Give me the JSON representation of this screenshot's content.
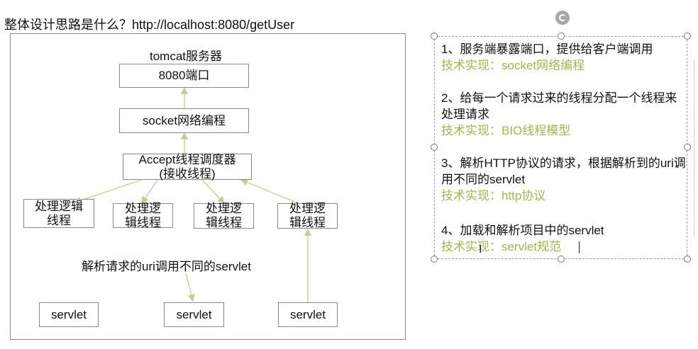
{
  "heading": "整体设计思路是什么？http://localhost:8080/getUser",
  "diagram": {
    "server_label": "tomcat服务器",
    "port_box": "8080端口",
    "socket_box": "socket网络编程",
    "accept_box": "Accept线程调度器\n(接收线程)",
    "workers": [
      "处理逻辑\n线程",
      "处理逻\n辑线程",
      "处理逻\n辑线程",
      "处理逻\n辑线程"
    ],
    "parse_label": "解析请求的uri调用不同的servlet",
    "servlets": [
      "servlet",
      "servlet",
      "servlet"
    ],
    "arrow_color": "#c7cc8f"
  },
  "notes": [
    {
      "text": "1、服务端暴露端口，提供给客户端调用",
      "tech": "技术实现：socket网络编程"
    },
    {
      "text": "2、给每一个请求过来的线程分配一个线程来处理请求",
      "tech": "技术实现：BIO线程模型"
    },
    {
      "text": "3、解析HTTP协议的请求，根据解析到的uri调用不同的servlet",
      "tech": "技术实现：http协议"
    },
    {
      "text": "4、加载和解析项目中的servlet",
      "tech": "技术实现：servlet规范"
    }
  ],
  "colors": {
    "tech": "#a4b64a",
    "border": "#888888"
  }
}
